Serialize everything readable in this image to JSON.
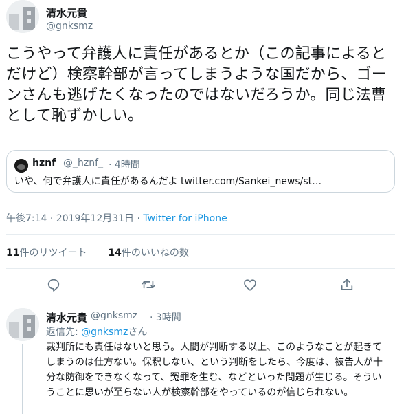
{
  "tweet": {
    "author_name": "清水元貴",
    "author_handle": "@gnksmz",
    "text": "こうやって弁護人に責任があるとか（この記事によるとだけど）検察幹部が言ってしまうような国だから、ゴーンさんも逃げたくなったのではないだろうか。同じ法曹として恥ずかしい。",
    "timestamp": "午後7:14 · 2019年12月31日 · ",
    "source": "Twitter for iPhone"
  },
  "quote": {
    "author_name": "hznf",
    "author_handle": "@_hznf_",
    "time": "· 4時間",
    "text": "いや、何で弁護人に責任があるんだよ twitter.com/Sankei_news/st…"
  },
  "stats": {
    "retweets_count": "11",
    "retweets_label": "件のリツイート",
    "likes_count": "14",
    "likes_label": "件のいいねの数"
  },
  "actions": {
    "reply_icon": "reply-icon",
    "retweet_icon": "retweet-icon",
    "like_icon": "heart-icon",
    "share_icon": "share-icon"
  },
  "reply": {
    "author_name": "清水元貴",
    "author_handle": "@gnksmz",
    "time": "· 3時間",
    "replying_prefix": "返信先: ",
    "replying_handle": "@gnksmz",
    "replying_suffix": "さん",
    "text": "裁判所にも責任はないと思う。人間が判断する以上、このようなことが起きてしまうのは仕方ない。保釈しない、という判断をしたら、今度は、被告人が十分な防御をできなくなって、冤罪を生む、などといった問題が生じる。そういうことに思いが至らない人が検察幹部をやっているのが信じられない。"
  },
  "colors": {
    "accent": "#1b95e0",
    "secondary_text": "#657786",
    "border": "#ccd6dd"
  }
}
